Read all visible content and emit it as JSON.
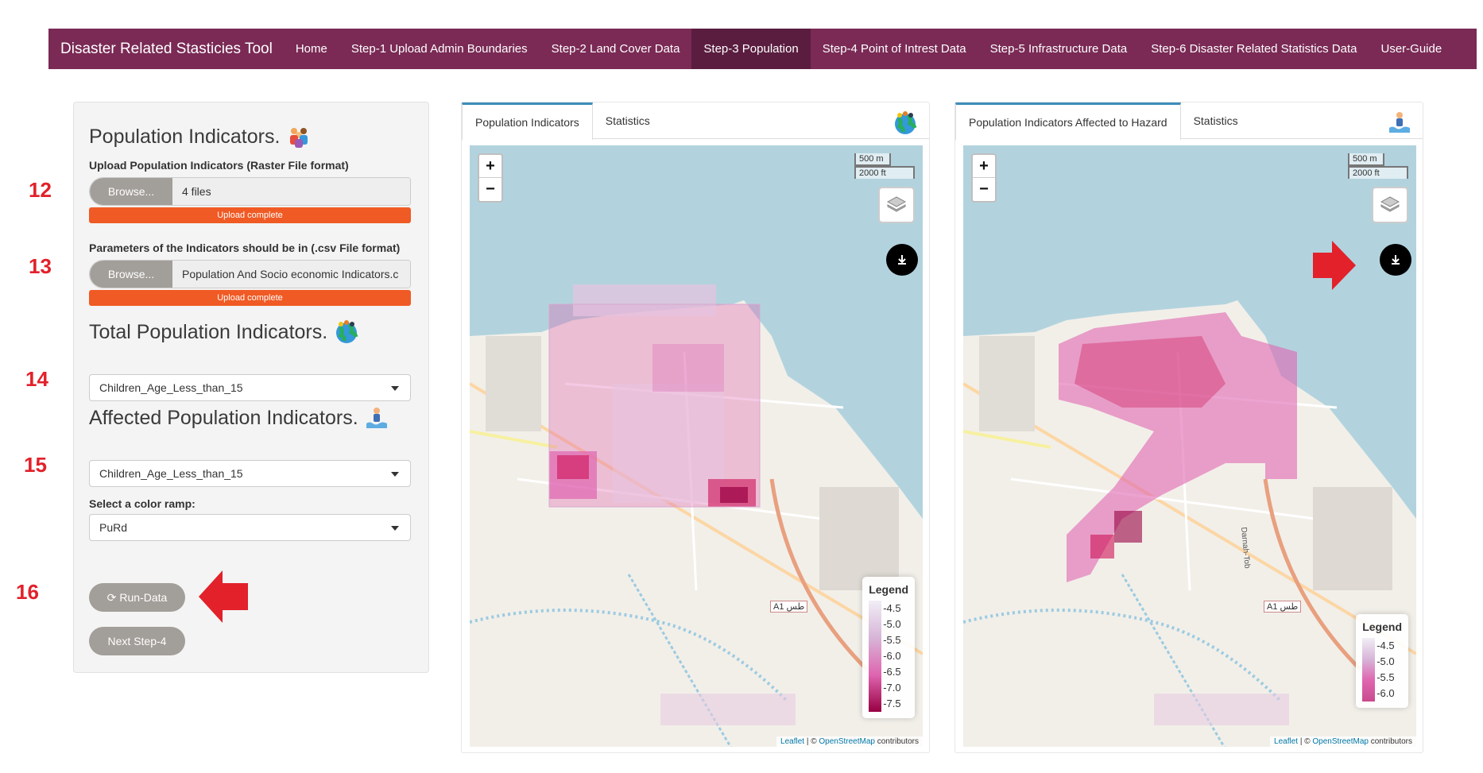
{
  "navbar": {
    "brand": "Disaster Related Stasticies Tool",
    "items": [
      {
        "label": "Home"
      },
      {
        "label": "Step-1 Upload Admin Boundaries"
      },
      {
        "label": "Step-2 Land Cover Data"
      },
      {
        "label": "Step-3 Population",
        "active": true
      },
      {
        "label": "Step-4 Point of Intrest Data"
      },
      {
        "label": "Step-5 Infrastructure Data"
      },
      {
        "label": "Step-6 Disaster Related Statistics Data"
      },
      {
        "label": "User-Guide"
      }
    ]
  },
  "annotations": {
    "n12": "12",
    "n13": "13",
    "n14": "14",
    "n15": "15",
    "n16": "16",
    "arrow_color": "#e2212a"
  },
  "sidebar": {
    "population_title": "Population Indicators.",
    "upload_label": "Upload Population Indicators (Raster File format)",
    "upload_browse": "Browse...",
    "upload_value": "4 files",
    "upload_status": "Upload complete",
    "params_label": "Parameters of the Indicators should be in (.csv File format)",
    "params_browse": "Browse...",
    "params_value": "Population And Socio economic Indicators.c",
    "params_status": "Upload complete",
    "total_title": "Total Population Indicators.",
    "total_select": "Children_Age_Less_than_15",
    "affected_title": "Affected Population Indicators.",
    "affected_select": "Children_Age_Less_than_15",
    "color_ramp_label": "Select a color ramp:",
    "color_ramp_value": "PuRd",
    "run_button": "Run-Data",
    "next_button": "Next Step-4"
  },
  "left_panel": {
    "tab_active": "Population Indicators",
    "tab_other": "Statistics",
    "tab_icon": "globe-people-icon",
    "scale_m": "500 m",
    "scale_ft": "2000 ft",
    "legend_title": "Legend",
    "legend_ticks": [
      "-4.5",
      "-5.0",
      "-5.5",
      "-6.0",
      "-6.5",
      "-7.0",
      "-7.5"
    ],
    "attribution_leaflet": "Leaflet",
    "attribution_sep": " | © ",
    "attribution_osm": "OpenStreetMap",
    "attribution_tail": " contributors"
  },
  "right_panel": {
    "tab_active": "Population Indicators Affected to Hazard",
    "tab_other": "Statistics",
    "tab_icon": "flood-person-icon",
    "scale_m": "500 m",
    "scale_ft": "2000 ft",
    "legend_title": "Legend",
    "legend_ticks": [
      "-4.5",
      "-5.0",
      "-5.5",
      "-6.0"
    ],
    "attribution_leaflet": "Leaflet",
    "attribution_sep": " | © ",
    "attribution_osm": "OpenStreetMap",
    "attribution_tail": " contributors"
  },
  "map_labels": {
    "road": "A1",
    "road_ar": "طس",
    "darnah": "Darnah-Tob"
  },
  "colors": {
    "navbar": "#7a2a55",
    "navbar_active": "#5a1d3f",
    "progress": "#f05a24",
    "button_grey": "#a29e99",
    "sea": "#b2d3de",
    "land": "#f2efe9",
    "pink_light": "#e7c3df",
    "pink_mid": "#df65b0",
    "pink_dark": "#980043"
  }
}
